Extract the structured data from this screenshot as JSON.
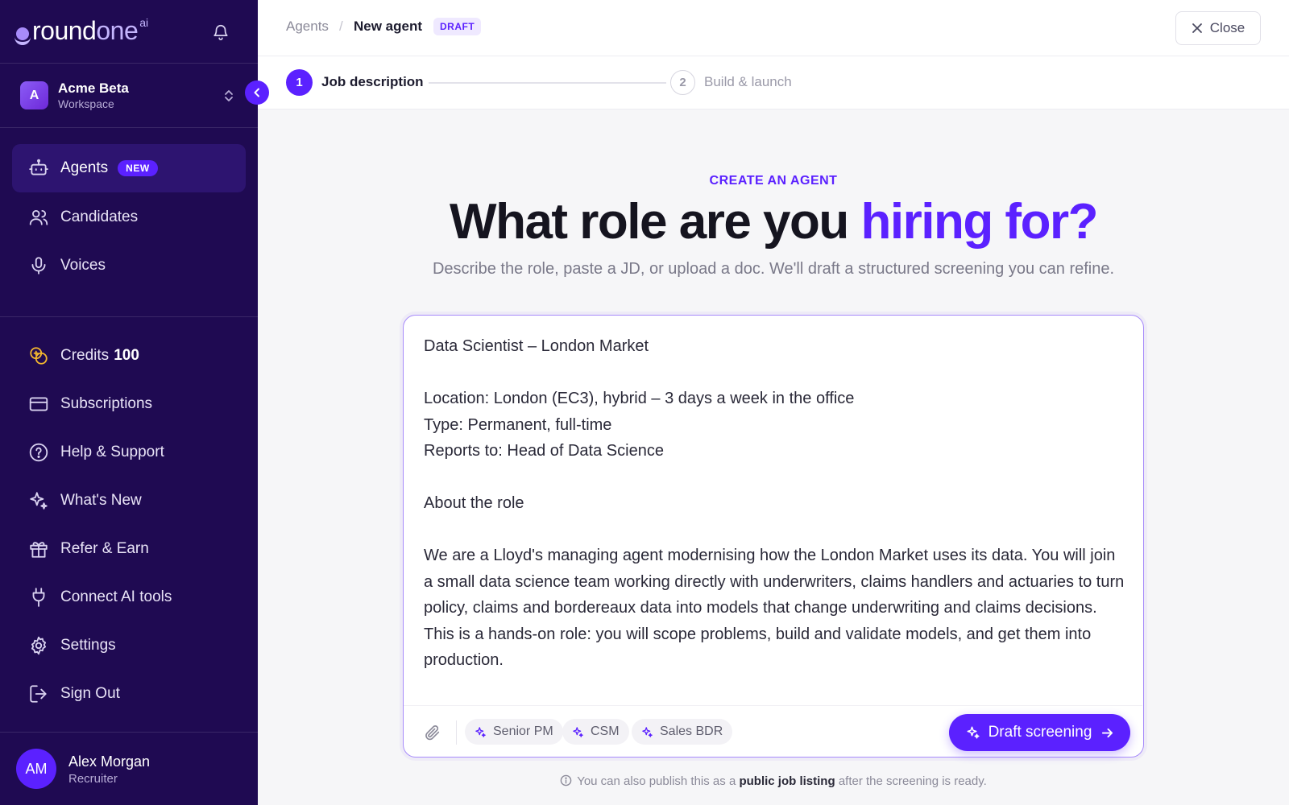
{
  "brand": {
    "round": "round",
    "one": "one",
    "ai": "ai"
  },
  "workspace": {
    "avatar_letter": "A",
    "name": "Acme Beta",
    "type": "Workspace"
  },
  "sidebar": {
    "primary": [
      {
        "label": "Agents",
        "badge": "NEW",
        "icon": "robot-icon",
        "active": true
      },
      {
        "label": "Candidates",
        "icon": "users-icon"
      },
      {
        "label": "Voices",
        "icon": "microphone-icon"
      }
    ],
    "credits": {
      "label": "Credits",
      "value": "100"
    },
    "secondary": [
      {
        "label": "Subscriptions",
        "icon": "credit-card-icon"
      },
      {
        "label": "Help & Support",
        "icon": "help-circle-icon"
      },
      {
        "label": "What's New",
        "icon": "sparkles-icon"
      },
      {
        "label": "Refer & Earn",
        "icon": "gift-icon"
      },
      {
        "label": "Connect AI tools",
        "icon": "plug-icon"
      },
      {
        "label": "Settings",
        "icon": "gear-icon"
      },
      {
        "label": "Sign Out",
        "icon": "sign-out-icon"
      }
    ]
  },
  "user": {
    "initials": "AM",
    "name": "Alex Morgan",
    "role": "Recruiter"
  },
  "header": {
    "breadcrumb_root": "Agents",
    "breadcrumb_sep": "/",
    "breadcrumb_current": "New agent",
    "status_badge": "DRAFT",
    "close_label": "Close"
  },
  "stepper": {
    "steps": [
      {
        "number": "1",
        "label": "Job description",
        "active": true
      },
      {
        "number": "2",
        "label": "Build & launch",
        "active": false
      }
    ]
  },
  "main": {
    "eyebrow": "CREATE AN AGENT",
    "headline_plain": "What role are you ",
    "headline_accent": "hiring for?",
    "subhead": "Describe the role, paste a JD, or upload a doc. We'll draft a structured screening you can refine.",
    "job_text": "Data Scientist – London Market\n\nLocation: London (EC3), hybrid – 3 days a week in the office\nType: Permanent, full-time\nReports to: Head of Data Science\n\nAbout the role\n\nWe are a Lloyd's managing agent modernising how the London Market uses its data. You will join a small data science team working directly with underwriters, claims handlers and actuaries to turn policy, claims and bordereaux data into models that change underwriting and claims decisions. This is a hands-on role: you will scope problems, build and validate models, and get them into production.",
    "templates": [
      "Senior PM",
      "CSM",
      "Sales BDR"
    ],
    "primary_action": "Draft screening",
    "footnote_before": "You can also publish this as a",
    "footnote_bold": "public job listing",
    "footnote_after": "after the screening is ready."
  },
  "colors": {
    "sidebar_bg": "#1f0a52",
    "accent": "#5b21ff",
    "accent_light": "#c4b5fd"
  }
}
